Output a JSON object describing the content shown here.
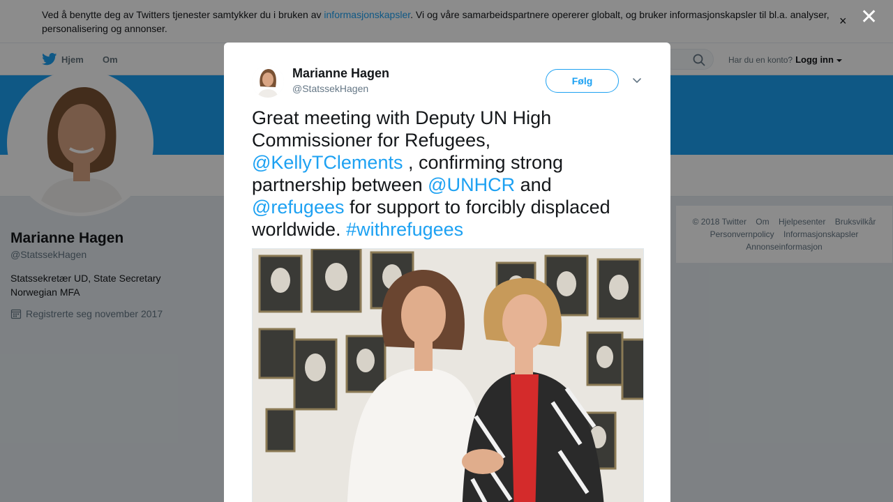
{
  "cookie_bar": {
    "text_before": "Ved å benytte deg av Twitters tjenester samtykker du i bruken av ",
    "link": "informasjonskapsler",
    "text_after": ". Vi og våre samarbeidspartnere opererer globalt, og bruker informasjonskapsler til bl.a. analyser, personalisering og annonser.",
    "close": "×"
  },
  "nav": {
    "home": "Hjem",
    "about": "Om",
    "account_prompt": "Har du en konto?",
    "login": "Logg inn"
  },
  "profile": {
    "name": "Marianne Hagen",
    "handle": "@StatssekHagen",
    "bio_line1": "Statssekretær UD, State Secretary",
    "bio_line2": "Norwegian MFA",
    "joined": "Registrerte seg november 2017"
  },
  "footer": {
    "items": [
      "© 2018 Twitter",
      "Om",
      "Hjelpesenter",
      "Bruksvilkår",
      "Personvernpolicy",
      "Informasjonskapsler",
      "Annonseinformasjon"
    ]
  },
  "overlay": {
    "close": "✕"
  },
  "tweet": {
    "author_name": "Marianne Hagen",
    "author_handle": "@StatssekHagen",
    "follow": "Følg",
    "t1": "Great meeting with Deputy UN High Commissioner for Refugees, ",
    "m1": "@KellyTClements",
    "t2": " , confirming strong partnership between ",
    "m2": "@UNHCR",
    "t3": " and ",
    "m3": "@refugees",
    "t4": " for support to forcibly displaced worldwide. ",
    "h1": "#withrefugees"
  },
  "colors": {
    "accent": "#1da1f2",
    "text": "#14171a",
    "muted": "#657786"
  },
  "icons": [
    "twitter-bird-icon",
    "search-icon",
    "calendar-icon",
    "chevron-down-icon",
    "close-icon"
  ]
}
